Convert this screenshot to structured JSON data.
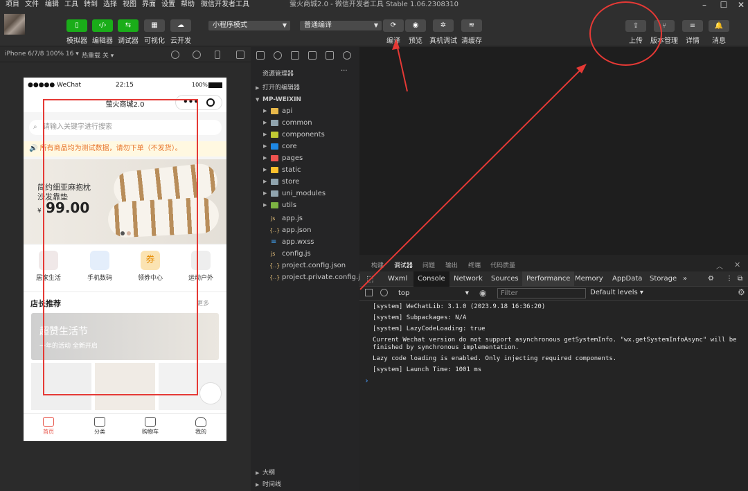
{
  "menu": [
    "项目",
    "文件",
    "编辑",
    "工具",
    "转到",
    "选择",
    "视图",
    "界面",
    "设置",
    "帮助",
    "微信开发者工具"
  ],
  "window_title": "萤火商城2.0 - 微信开发者工具 Stable 1.06.2308310",
  "toolbar": {
    "left_buttons": [
      "模拟器",
      "编辑器",
      "调试器",
      "可视化",
      "云开发"
    ],
    "mode_select": "小程序模式",
    "compile_select": "普通编译",
    "mid_buttons": [
      "编译",
      "预览",
      "真机调试",
      "清缓存"
    ],
    "right_buttons": [
      "上传",
      "版本管理",
      "详情",
      "消息"
    ]
  },
  "device_bar": {
    "device": "iPhone 6/7/8 100% 16 ▾",
    "hot_reload": "热重载 关 ▾"
  },
  "phone": {
    "carrier": "●●●●● WeChat",
    "time": "22:15",
    "battery": "100%",
    "nav_title": "萤火商城2.0",
    "search_placeholder": "请输入关键字进行搜索",
    "notice": "所有商品均为测试数据，请勿下单（不发货）。",
    "banner_text_line1": "简约细亚麻抱枕",
    "banner_text_line2": "沙发靠垫",
    "banner_currency": "¥",
    "banner_price": "99.00",
    "categories": [
      "居家生活",
      "手机数码",
      "领券中心",
      "运动户外"
    ],
    "coupon_glyph": "券",
    "section_title": "店长推荐",
    "section_more": "更多",
    "promo_title": "超赞生活节",
    "promo_sub": "一年的活动 全新开启",
    "tabs": [
      "首页",
      "分类",
      "购物车",
      "我的"
    ]
  },
  "explorer": {
    "title": "资源管理器",
    "more": "···",
    "open_editors": "打开的编辑器",
    "root": "MP-WEIXIN",
    "folders": [
      "api",
      "common",
      "components",
      "core",
      "pages",
      "static",
      "store",
      "uni_modules",
      "utils"
    ],
    "files": [
      "app.js",
      "app.json",
      "app.wxss",
      "config.js",
      "project.config.json",
      "project.private.config.js..."
    ],
    "file_icons": [
      "js",
      "{..}",
      "≡",
      "js",
      "{..}",
      "{..}"
    ],
    "outline": "大纲",
    "timeline": "时间线"
  },
  "devtools": {
    "top_tabs": [
      "构建",
      "调试器",
      "问题",
      "输出",
      "终端",
      "代码质量"
    ],
    "tabs": [
      "Wxml",
      "Console",
      "Network",
      "Sources",
      "Performance",
      "Memory",
      "AppData",
      "Storage",
      "»"
    ],
    "active_tab": "Console",
    "context": "top",
    "filter_placeholder": "Filter",
    "levels": "Default levels ▾",
    "logs": [
      "[system] WeChatLib: 3.1.0 (2023.9.18 16:36:20)",
      "[system] Subpackages: N/A",
      "[system] LazyCodeLoading: true",
      "Current Wechat version do not support asynchronous getSystemInfo. \"wx.getSystemInfoAsync\" will be",
      "finished by synchronous implementation.",
      "Lazy code loading is enabled. Only injecting required components.",
      "[system] Launch Time: 1001 ms"
    ],
    "prompt": "›"
  },
  "colors": {
    "annotation": "#e53935",
    "accent_green": "#1aad19",
    "brand_red": "#e85a4f"
  }
}
